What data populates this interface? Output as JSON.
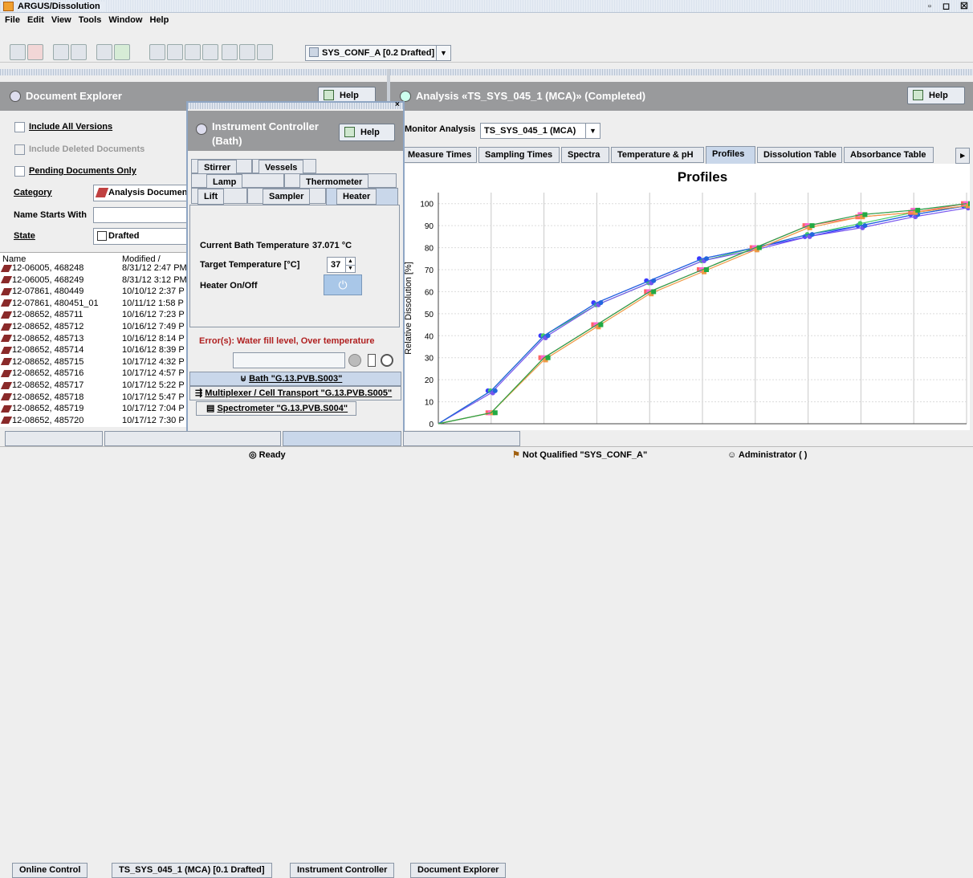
{
  "window": {
    "title": "ARGUS/Dissolution"
  },
  "menu": [
    "File",
    "Edit",
    "View",
    "Tools",
    "Window",
    "Help"
  ],
  "toolbar": {
    "config_select": "SYS_CONF_A [0.2 Drafted]"
  },
  "explorer": {
    "title": "Document Explorer",
    "help": "Help",
    "include_all_versions": "Include All Versions",
    "include_deleted": "Include Deleted Documents",
    "pending_only": "Pending Documents Only",
    "category_label": "Category",
    "category_value": "Analysis Documen",
    "name_starts_label": "Name Starts With",
    "state_label": "State",
    "state_value": "Drafted",
    "col_name": "Name",
    "col_modified": "Modified /",
    "rows": [
      {
        "name": "12-06005, 468248",
        "date": "8/31/12 2:47 PM"
      },
      {
        "name": "12-06005, 468249",
        "date": "8/31/12 3:12 PM"
      },
      {
        "name": "12-07861, 480449",
        "date": "10/10/12 2:37 P"
      },
      {
        "name": "12-07861, 480451_01",
        "date": "10/11/12 1:58 P"
      },
      {
        "name": "12-08652, 485711",
        "date": "10/16/12 7:23 P"
      },
      {
        "name": "12-08652, 485712",
        "date": "10/16/12 7:49 P"
      },
      {
        "name": "12-08652, 485713",
        "date": "10/16/12 8:14 P"
      },
      {
        "name": "12-08652, 485714",
        "date": "10/16/12 8:39 P"
      },
      {
        "name": "12-08652, 485715",
        "date": "10/17/12 4:32 P"
      },
      {
        "name": "12-08652, 485716",
        "date": "10/17/12 4:57 P"
      },
      {
        "name": "12-08652, 485717",
        "date": "10/17/12 5:22 P"
      },
      {
        "name": "12-08652, 485718",
        "date": "10/17/12 5:47 P"
      },
      {
        "name": "12-08652, 485719",
        "date": "10/17/12 7:04 P"
      },
      {
        "name": "12-08652, 485720",
        "date": "10/17/12 7:30 P"
      }
    ]
  },
  "controller": {
    "title_line1": "Instrument Controller",
    "title_line2": "(Bath)",
    "help": "Help",
    "tabs_row1": [
      "Stirrer",
      "Vessels"
    ],
    "tabs_row2": [
      "Lamp",
      "Thermometer"
    ],
    "tabs_row3": [
      "Lift",
      "Sampler",
      "Heater"
    ],
    "current_temp_label": "Current Bath Temperature",
    "current_temp_value": "37.071 °C",
    "target_temp_label": "Target Temperature [°C]",
    "target_temp_value": "37",
    "heater_label": "Heater On/Off",
    "error": "Error(s): Water fill level, Over temperature",
    "bath": "Bath \"G.13.PVB.S003\"",
    "multiplexer": "Multiplexer / Cell Transport \"G.13.PVB.S005\"",
    "spectrometer": "Spectrometer \"G.13.PVB.S004\""
  },
  "analysis": {
    "title": "Analysis «TS_SYS_045_1 (MCA)» (Completed)",
    "help": "Help",
    "monitor_label": "Monitor Analysis",
    "monitor_value": "TS_SYS_045_1 (MCA)",
    "tabs": [
      "Measure Times",
      "Sampling Times",
      "Spectra",
      "Temperature & pH",
      "Profiles",
      "Dissolution Table",
      "Absorbance Table"
    ]
  },
  "chart_data": {
    "type": "line",
    "title": "Profiles",
    "ylabel": "Relative Dissolution [%]",
    "xlabel": "",
    "ylim": [
      0,
      105
    ],
    "yticks": [
      0,
      10,
      20,
      30,
      40,
      50,
      60,
      70,
      80,
      90,
      100
    ],
    "x": [
      0,
      1,
      2,
      3,
      4,
      5,
      6,
      7,
      8,
      9,
      10
    ],
    "series": [
      {
        "color": "#3a3aff",
        "values": [
          0,
          15,
          40,
          55,
          65,
          75,
          80,
          85,
          90,
          95,
          99
        ]
      },
      {
        "color": "#44cc66",
        "values": [
          0,
          15,
          40,
          54,
          64,
          74,
          80,
          86,
          91,
          96,
          99
        ]
      },
      {
        "color": "#7755ee",
        "values": [
          0,
          14,
          39,
          54,
          64,
          74,
          79,
          85,
          89,
          94,
          98
        ]
      },
      {
        "color": "#2266dd",
        "values": [
          0,
          15,
          40,
          55,
          65,
          75,
          80,
          86,
          90,
          95,
          99
        ]
      },
      {
        "color": "#ff6666",
        "values": [
          0,
          5,
          30,
          45,
          60,
          70,
          80,
          90,
          94,
          96,
          100
        ]
      },
      {
        "color": "#ff66cc",
        "values": [
          0,
          5,
          30,
          45,
          60,
          70,
          80,
          90,
          95,
          97,
          100
        ]
      },
      {
        "color": "#ee9944",
        "values": [
          0,
          5,
          29,
          44,
          59,
          69,
          79,
          89,
          94,
          96,
          99
        ]
      },
      {
        "color": "#22aa44",
        "values": [
          0,
          5,
          30,
          45,
          60,
          70,
          80,
          90,
          95,
          97,
          100
        ]
      }
    ]
  },
  "bottom_tabs": [
    "Online Control",
    "TS_SYS_045_1 (MCA) [0.1 Drafted]",
    "Instrument Controller",
    "Document Explorer"
  ],
  "status": {
    "ready": "Ready",
    "qualification": "Not Qualified \"SYS_CONF_A\"",
    "user": "Administrator ( )"
  }
}
